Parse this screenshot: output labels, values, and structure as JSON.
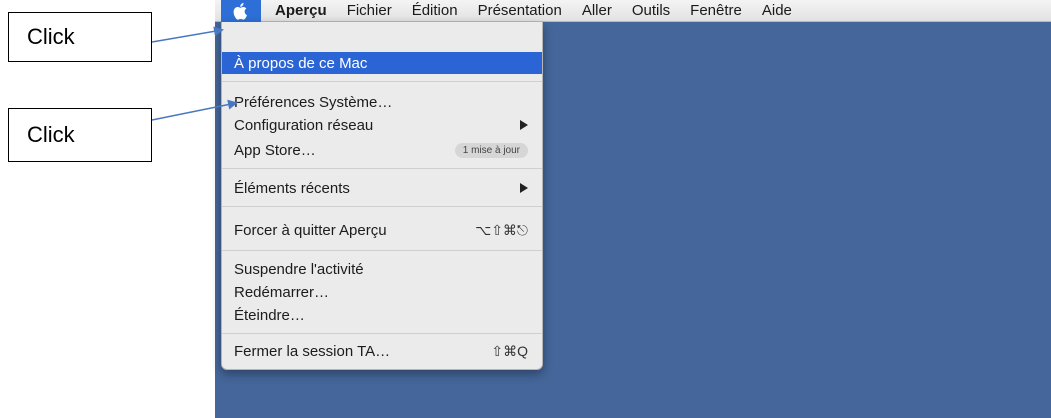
{
  "annotations": {
    "callout_1": "Click",
    "callout_2": "Click"
  },
  "menubar": {
    "apple_icon": "apple-icon",
    "items": [
      "Aperçu",
      "Fichier",
      "Édition",
      "Présentation",
      "Aller",
      "Outils",
      "Fenêtre",
      "Aide"
    ]
  },
  "apple_menu": {
    "about": "À propos de ce Mac",
    "system_prefs": "Préférences Système…",
    "network_config": "Configuration réseau",
    "app_store": "App Store…",
    "app_store_badge": "1 mise à jour",
    "recent_items": "Éléments récents",
    "force_quit": "Forcer à quitter Aperçu",
    "force_quit_shortcut": "⌥⇧⌘⎋",
    "sleep": "Suspendre l'activité",
    "restart": "Redémarrer…",
    "shutdown": "Éteindre…",
    "logout": "Fermer la session TA…",
    "logout_shortcut": "⇧⌘Q"
  },
  "colors": {
    "desktop": "#44669a",
    "highlight": "#2b64d4",
    "arrow": "#4a78c0"
  }
}
